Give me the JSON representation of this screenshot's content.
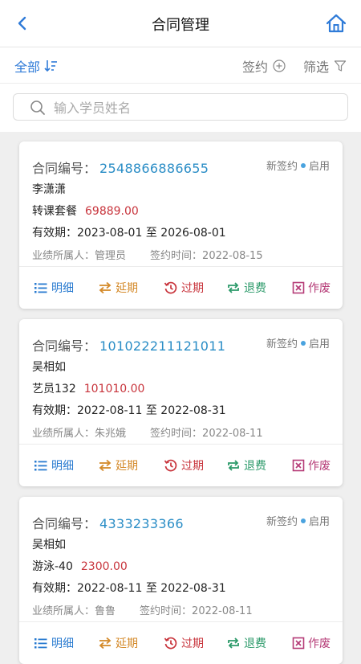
{
  "nav": {
    "title": "合同管理"
  },
  "filter": {
    "all_label": "全部",
    "sign_label": "签约",
    "screen_label": "筛选"
  },
  "search": {
    "placeholder": "输入学员姓名"
  },
  "labels": {
    "contract_no": "合同编号：",
    "validity_prefix": "有效期：",
    "validity_to": "至",
    "owner_prefix": "业绩所属人：",
    "sign_time_prefix": "签约时间："
  },
  "actions": {
    "detail": "明细",
    "extend": "延期",
    "expire": "过期",
    "refund": "退费",
    "void": "作废"
  },
  "contracts": [
    {
      "contract_no": "2548866886655",
      "type": "新签约",
      "status": "启用",
      "student": "李潇潇",
      "package": "转课套餐",
      "price": "69889.00",
      "start": "2023-08-01",
      "end": "2026-08-01",
      "owner": "管理员",
      "sign_time": "2022-08-15"
    },
    {
      "contract_no": "101022211121011",
      "type": "新签约",
      "status": "启用",
      "student": "吴相如",
      "package": "艺员132",
      "price": "101010.00",
      "start": "2022-08-11",
      "end": "2022-08-31",
      "owner": "朱兆娥",
      "sign_time": "2022-08-11"
    },
    {
      "contract_no": "4333233366",
      "type": "新签约",
      "status": "启用",
      "student": "吴相如",
      "package": "游泳-40",
      "price": "2300.00",
      "start": "2022-08-11",
      "end": "2022-08-31",
      "owner": "鲁鲁",
      "sign_time": "2022-08-11"
    }
  ]
}
